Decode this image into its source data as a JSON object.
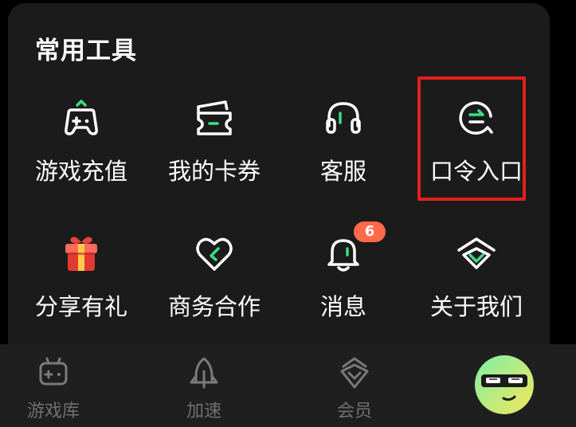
{
  "card": {
    "title": "常用工具"
  },
  "tools": [
    {
      "label": "游戏充值",
      "icon": "gamepad-icon"
    },
    {
      "label": "我的卡券",
      "icon": "coupon-icon"
    },
    {
      "label": "客服",
      "icon": "headset-icon"
    },
    {
      "label": "口令入口",
      "icon": "exchange-icon"
    },
    {
      "label": "分享有礼",
      "icon": "gift-icon"
    },
    {
      "label": "商务合作",
      "icon": "heart-handshake-icon"
    },
    {
      "label": "消息",
      "icon": "bell-icon",
      "badge": "6"
    },
    {
      "label": "关于我们",
      "icon": "logo-icon"
    }
  ],
  "bottom_nav": [
    {
      "label": "游戏库",
      "icon": "game-library-icon"
    },
    {
      "label": "加速",
      "icon": "rocket-icon"
    },
    {
      "label": "会员",
      "icon": "diamond-icon"
    },
    {
      "label": "",
      "icon": "avatar-sunglasses-icon"
    }
  ],
  "colors": {
    "background": "#000000",
    "card": "#1b1b1b",
    "accent_green": "#3ddc84",
    "badge": "#ff6a4a",
    "highlight": "#e5201c",
    "nav_text": "#707070"
  }
}
